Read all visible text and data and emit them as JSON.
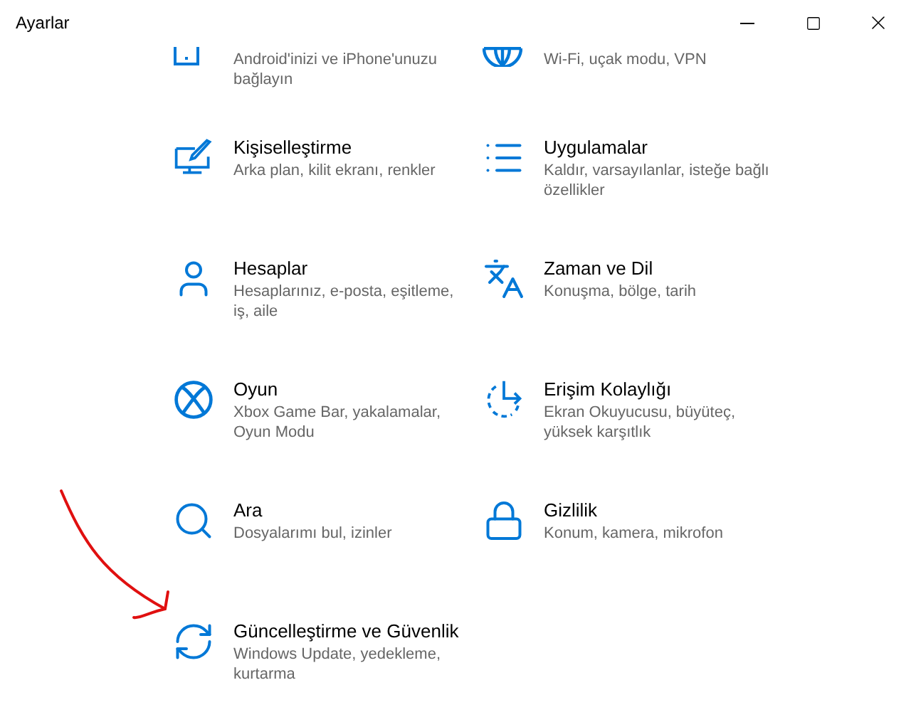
{
  "window": {
    "title": "Ayarlar"
  },
  "categories": [
    {
      "description": "Android'inizi ve iPhone'unuzu bağlayın"
    },
    {
      "description": "Wi-Fi, uçak modu, VPN"
    },
    {
      "title": "Kişiselleştirme",
      "description": "Arka plan, kilit ekranı, renkler"
    },
    {
      "title": "Uygulamalar",
      "description": "Kaldır, varsayılanlar, isteğe bağlı özellikler"
    },
    {
      "title": "Hesaplar",
      "description": "Hesaplarınız, e-posta, eşitleme, iş, aile"
    },
    {
      "title": "Zaman ve Dil",
      "description": "Konuşma, bölge, tarih"
    },
    {
      "title": "Oyun",
      "description": "Xbox Game Bar, yakalamalar, Oyun Modu"
    },
    {
      "title": "Erişim Kolaylığı",
      "description": "Ekran Okuyucusu, büyüteç, yüksek karşıtlık"
    },
    {
      "title": "Ara",
      "description": "Dosyalarımı bul, izinler"
    },
    {
      "title": "Gizlilik",
      "description": "Konum, kamera, mikrofon"
    },
    {
      "title": "Güncelleştirme ve Güvenlik",
      "description": "Windows Update, yedekleme, kurtarma"
    }
  ]
}
